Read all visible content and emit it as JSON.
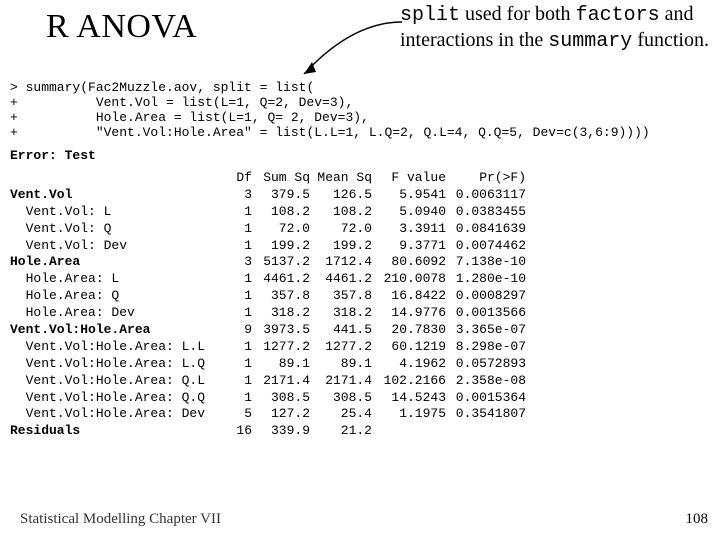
{
  "title": "R ANOVA",
  "annotation": {
    "pre1": "",
    "mono1": "split",
    "mid1": " used for both ",
    "mono2": "factors",
    "mid2": " and interactions in the ",
    "mono3": "summary",
    "post": " function."
  },
  "code_lines": [
    "> summary(Fac2Muzzle.aov, split = list(",
    "+          Vent.Vol = list(L=1, Q=2, Dev=3),",
    "+          Hole.Area = list(L=1, Q= 2, Dev=3),",
    "+          \"Vent.Vol:Hole.Area\" = list(L.L=1, L.Q=2, Q.L=4, Q.Q=5, Dev=c(3,6:9))))"
  ],
  "error_line": "Error: Test",
  "table_header": [
    "",
    "Df",
    "Sum Sq",
    "Mean Sq",
    "F value",
    "Pr(>F)"
  ],
  "rows": [
    {
      "label": "Vent.Vol",
      "df": "3",
      "ssq": "379.5",
      "msq": "126.5",
      "f": "5.9541",
      "p": "0.0063117",
      "bold": true
    },
    {
      "label": "  Vent.Vol: L",
      "df": "1",
      "ssq": "108.2",
      "msq": "108.2",
      "f": "5.0940",
      "p": "0.0383455",
      "bold": false
    },
    {
      "label": "  Vent.Vol: Q",
      "df": "1",
      "ssq": "72.0",
      "msq": "72.0",
      "f": "3.3911",
      "p": "0.0841639",
      "bold": false
    },
    {
      "label": "  Vent.Vol: Dev",
      "df": "1",
      "ssq": "199.2",
      "msq": "199.2",
      "f": "9.3771",
      "p": "0.0074462",
      "bold": false
    },
    {
      "label": "Hole.Area",
      "df": "3",
      "ssq": "5137.2",
      "msq": "1712.4",
      "f": "80.6092",
      "p": "7.138e-10",
      "bold": true
    },
    {
      "label": "  Hole.Area: L",
      "df": "1",
      "ssq": "4461.2",
      "msq": "4461.2",
      "f": "210.0078",
      "p": "1.280e-10",
      "bold": false
    },
    {
      "label": "  Hole.Area: Q",
      "df": "1",
      "ssq": "357.8",
      "msq": "357.8",
      "f": "16.8422",
      "p": "0.0008297",
      "bold": false
    },
    {
      "label": "  Hole.Area: Dev",
      "df": "1",
      "ssq": "318.2",
      "msq": "318.2",
      "f": "14.9776",
      "p": "0.0013566",
      "bold": false
    },
    {
      "label": "Vent.Vol:Hole.Area",
      "df": "9",
      "ssq": "3973.5",
      "msq": "441.5",
      "f": "20.7830",
      "p": "3.365e-07",
      "bold": true
    },
    {
      "label": "  Vent.Vol:Hole.Area: L.L",
      "df": "1",
      "ssq": "1277.2",
      "msq": "1277.2",
      "f": "60.1219",
      "p": "8.298e-07",
      "bold": false
    },
    {
      "label": "  Vent.Vol:Hole.Area: L.Q",
      "df": "1",
      "ssq": "89.1",
      "msq": "89.1",
      "f": "4.1962",
      "p": "0.0572893",
      "bold": false
    },
    {
      "label": "  Vent.Vol:Hole.Area: Q.L",
      "df": "1",
      "ssq": "2171.4",
      "msq": "2171.4",
      "f": "102.2166",
      "p": "2.358e-08",
      "bold": false
    },
    {
      "label": "  Vent.Vol:Hole.Area: Q.Q",
      "df": "1",
      "ssq": "308.5",
      "msq": "308.5",
      "f": "14.5243",
      "p": "0.0015364",
      "bold": false
    },
    {
      "label": "  Vent.Vol:Hole.Area: Dev",
      "df": "5",
      "ssq": "127.2",
      "msq": "25.4",
      "f": "1.1975",
      "p": "0.3541807",
      "bold": false
    },
    {
      "label": "Residuals",
      "df": "16",
      "ssq": "339.9",
      "msq": "21.2",
      "f": "",
      "p": "",
      "bold": true
    }
  ],
  "footer": "Statistical Modelling  Chapter VII",
  "pagenum": "108"
}
